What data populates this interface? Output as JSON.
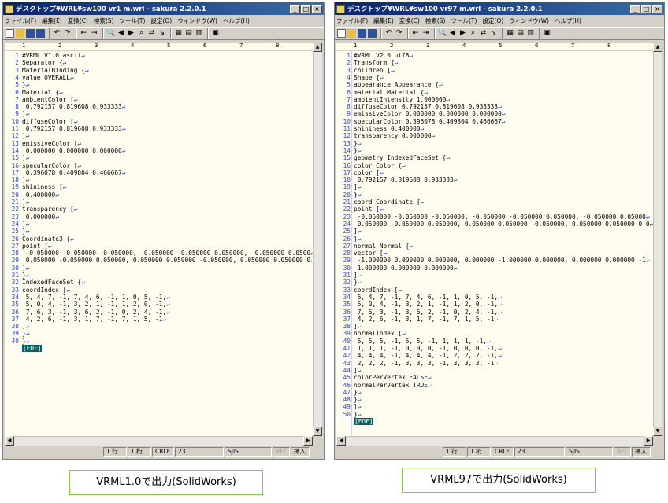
{
  "left": {
    "title": "デスクトップ¥WRL¥sw100 vr1 m.wrl - sakura 2.2.0.1",
    "menus": [
      "ファイル(F)",
      "編集(E)",
      "変換(C)",
      "検索(S)",
      "ツール(T)",
      "設定(O)",
      "ウィンドウ(W)",
      "ヘルプ(H)"
    ],
    "lines": [
      "#VRML V1.0 ascii",
      "Separator {",
      "MaterialBinding {",
      "value OVERALL",
      "}",
      "Material {",
      "ambientColor [",
      " 0.792157 0.819608 0.933333",
      "]",
      "diffuseColor [",
      " 0.792157 0.819608 0.933333",
      "]",
      "emissiveColor [",
      " 0.000000 0.000000 0.000000",
      "]",
      "specularColor [",
      " 0.396078 0.409804 0.466667",
      "]",
      "shininess [",
      " 0.400000",
      "]",
      "transparency [",
      " 0.000000",
      "]",
      "}",
      "Coordinate3 {",
      "point [",
      " -0.050000 -0.050000 -0.050000, -0.050000 -0.050000 0.050000, -0.050000 0.0500",
      " 0.050000 -0.050000 0.050000, 0.050000 0.050000 -0.050000, 0.050000 0.050000 0",
      "]",
      "}",
      "IndexedFaceSet {",
      "coordIndex [",
      " 5, 4, 7, -1, 7, 4, 6, -1, 1, 0, 5, -1,",
      " 5, 0, 4, -1, 3, 2, 1, -1, 1, 2, 0, -1,",
      " 7, 6, 3, -1, 3, 6, 2, -1, 0, 2, 4, -1,",
      " 4, 2, 6, -1, 3, 1, 7, -1, 7, 1, 5, -1",
      "]",
      "}",
      "}"
    ],
    "status": {
      "row": "1 行",
      "col": "1 桁",
      "eol": "CRLF",
      "code": "23",
      "enc": "SJIS",
      "rec": "REC",
      "mode": "挿入"
    }
  },
  "right": {
    "title": "デスクトップ¥WRL¥sw100 vr97 m.wrl - sakura 2.2.0.1",
    "menus": [
      "ファイル(F)",
      "編集(E)",
      "変換(C)",
      "検索(S)",
      "ツール(T)",
      "設定(O)",
      "ウィンドウ(W)",
      "ヘルプ(H)"
    ],
    "lines": [
      "#VRML V2.0 utf8",
      "Transform {",
      "children [",
      "Shape {",
      "appearance Appearance {",
      "material Material {",
      "ambientIntensity 1.000000",
      "diffuseColor 0.792157 0.819608 0.933333",
      "emissiveColor 0.000000 0.000000 0.000000",
      "specularColor 0.396078 0.409804 0.466667",
      "shininess 0.400000",
      "transparency 0.000000",
      "}",
      "}",
      "geometry IndexedFaceSet {",
      "color Color {",
      "color [",
      " 0.792157 0.819608 0.933333",
      "]",
      "}",
      "coord Coordinate {",
      "point [",
      " -0.050000 -0.050000 -0.050000, -0.050000 -0.050000 0.050000, -0.050000 0.05000",
      " 0.050000 -0.050000 0.050000, 0.050000 0.050000 -0.050000, 0.050000 0.050000 0.0",
      "]",
      "}",
      "normal Normal {",
      "vector [",
      " -1.000000 0.000000 0.000000, 0.000000 -1.000000 0.000000, 0.000000 0.000000 -1",
      " 1.000000 0.000000 0.000000",
      "]",
      "}",
      "coordIndex [",
      " 5, 4, 7, -1, 7, 4, 6, -1, 1, 0, 5, -1,",
      " 5, 0, 4, -1, 3, 2, 1, -1, 1, 2, 0, -1,",
      " 7, 6, 3, -1, 3, 6, 2, -1, 0, 2, 4, -1,",
      " 4, 2, 6, -1, 3, 1, 7, -1, 7, 1, 5, -1",
      "]",
      "normalIndex [",
      " 5, 5, 5, -1, 5, 5, -1, 1, 1, 1, -1,",
      " 1, 1, 1, -1, 0, 0, 0, -1, 0, 0, 0, -1,",
      " 4, 4, 4, -1, 4, 4, 4, -1, 2, 2, 2, -1,",
      " 2, 2, 2, -1, 3, 3, 3, -1, 3, 3, 3, -1",
      "]",
      "colorPerVertex FALSE",
      "normalPerVertex TRUE",
      "}",
      "}",
      "]",
      "}"
    ],
    "status": {
      "row": "1 行",
      "col": "1 桁",
      "eol": "CRLF",
      "code": "23",
      "enc": "SJIS",
      "rec": "REC",
      "mode": "挿入"
    }
  },
  "eof_label": "[EOF]",
  "caption_left": "VRML1.0で出力(SolidWorks)",
  "caption_right": "VRML97で出力(SolidWorks)",
  "ruler_marks": [
    "1",
    "2",
    "3",
    "4",
    "5",
    "6",
    "7",
    "8"
  ]
}
